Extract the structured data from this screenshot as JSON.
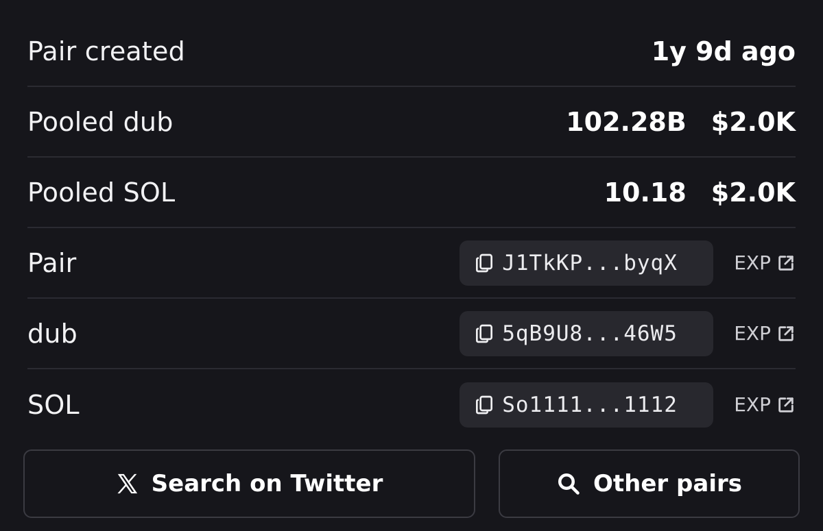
{
  "rows": [
    {
      "label": "Pair created",
      "value": "1y 9d ago"
    },
    {
      "label": "Pooled dub",
      "amount": "102.28B",
      "usd": "$2.0K"
    },
    {
      "label": "Pooled SOL",
      "amount": "10.18",
      "usd": "$2.0K"
    }
  ],
  "addresses": [
    {
      "label": "Pair",
      "address": "J1TkKP...byqX",
      "link": "EXP"
    },
    {
      "label": "dub",
      "address": "5qB9U8...46W5",
      "link": "EXP"
    },
    {
      "label": "SOL",
      "address": "So1111...1112",
      "link": "EXP"
    }
  ],
  "buttons": {
    "twitter": "Search on Twitter",
    "pairs": "Other pairs"
  },
  "icons": {
    "copy": "copy-icon",
    "external": "external-link-icon",
    "x_logo": "x-logo-icon",
    "search": "search-icon"
  },
  "colors": {
    "background": "#16161b",
    "chip": "#28282e",
    "divider": "#2b2b32",
    "text": "#ffffff",
    "muted": "#cfcfd4"
  }
}
